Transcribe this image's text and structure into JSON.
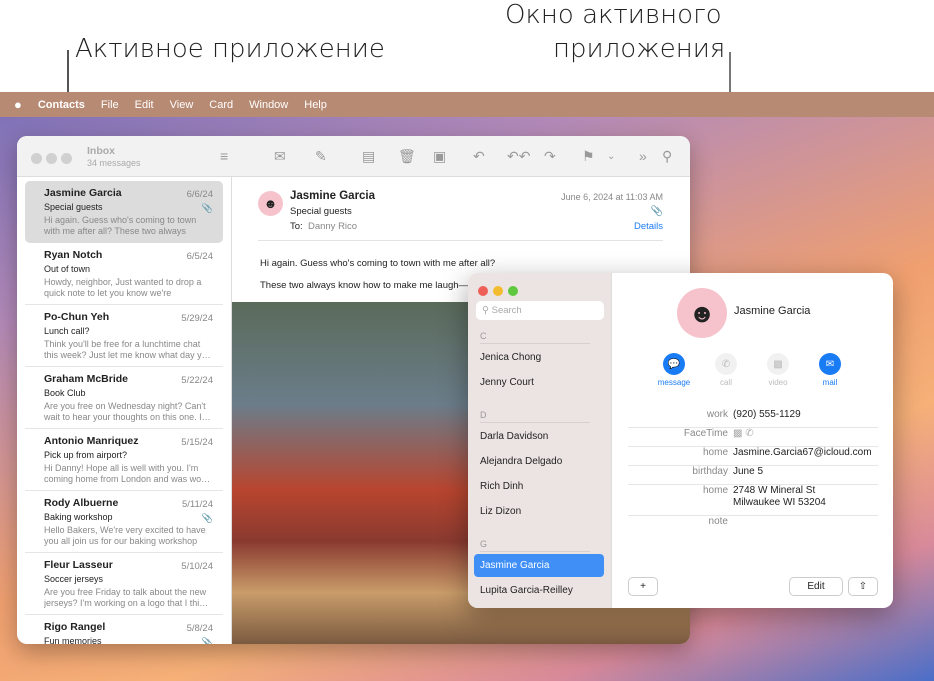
{
  "callouts": {
    "active_app": "Активное приложение",
    "active_window_1": "Окно активного",
    "active_window_2": "приложения"
  },
  "menubar": {
    "apple": "",
    "items": [
      "Contacts",
      "File",
      "Edit",
      "View",
      "Card",
      "Window",
      "Help"
    ]
  },
  "mail": {
    "title": "Inbox",
    "subtitle": "34 messages",
    "messages": [
      {
        "name": "Jasmine Garcia",
        "date": "6/6/24",
        "subject": "Special guests",
        "preview": "Hi again. Guess who's coming to town with me after all? These two always kno…",
        "attachment": true
      },
      {
        "name": "Ryan Notch",
        "date": "6/5/24",
        "subject": "Out of town",
        "preview": "Howdy, neighbor, Just wanted to drop a quick note to let you know we're leaving…",
        "attachment": false
      },
      {
        "name": "Po-Chun Yeh",
        "date": "5/29/24",
        "subject": "Lunch call?",
        "preview": "Think you'll be free for a lunchtime chat this week? Just let me know what day y…",
        "attachment": false
      },
      {
        "name": "Graham McBride",
        "date": "5/22/24",
        "subject": "Book Club",
        "preview": "Are you free on Wednesday night? Can't wait to hear your thoughts on this one. I…",
        "attachment": false
      },
      {
        "name": "Antonio Manriquez",
        "date": "5/15/24",
        "subject": "Pick up from airport?",
        "preview": "Hi Danny! Hope all is well with you. I'm coming home from London and was wo…",
        "attachment": false
      },
      {
        "name": "Rody Albuerne",
        "date": "5/11/24",
        "subject": "Baking workshop",
        "preview": "Hello Bakers, We're very excited to have you all join us for our baking workshop t…",
        "attachment": true
      },
      {
        "name": "Fleur Lasseur",
        "date": "5/10/24",
        "subject": "Soccer jerseys",
        "preview": "Are you free Friday to talk about the new jerseys? I'm working on a logo that I thi…",
        "attachment": false
      },
      {
        "name": "Rigo Rangel",
        "date": "5/8/24",
        "subject": "Fun memories",
        "preview": "",
        "attachment": true
      }
    ],
    "reader": {
      "from": "Jasmine Garcia",
      "subject": "Special guests",
      "to_label": "To:",
      "to": "Danny Rico",
      "date": "June 6, 2024 at 11:03 AM",
      "details": "Details",
      "body1": "Hi again. Guess who's coming to town with me after all?",
      "body2": "These two always know how to make me laugh—a"
    }
  },
  "contacts": {
    "search_placeholder": "Search",
    "sections": [
      {
        "letter": "C",
        "names": [
          "Jenica Chong",
          "Jenny Court"
        ]
      },
      {
        "letter": "D",
        "names": [
          "Darla Davidson",
          "Alejandra Delgado",
          "Rich Dinh",
          "Liz Dizon"
        ]
      },
      {
        "letter": "G",
        "names": [
          "Jasmine Garcia",
          "Lupita Garcia-Reilley"
        ]
      }
    ],
    "selected": "Jasmine Garcia",
    "card": {
      "name": "Jasmine Garcia",
      "actions": [
        "message",
        "call",
        "video",
        "mail"
      ],
      "fields": [
        {
          "label": "work",
          "value": "(920) 555-1129"
        },
        {
          "label": "FaceTime",
          "value": ""
        },
        {
          "label": "home",
          "value": "Jasmine.Garcia67@icloud.com"
        },
        {
          "label": "birthday",
          "value": "June 5"
        },
        {
          "label": "home",
          "value": "2748 W Mineral St",
          "value2": "Milwaukee WI 53204"
        },
        {
          "label": "note",
          "value": ""
        }
      ]
    },
    "add": "+",
    "edit": "Edit"
  },
  "colors": {
    "accent": "#1a7cf5",
    "selected": "#3f8ff7"
  }
}
